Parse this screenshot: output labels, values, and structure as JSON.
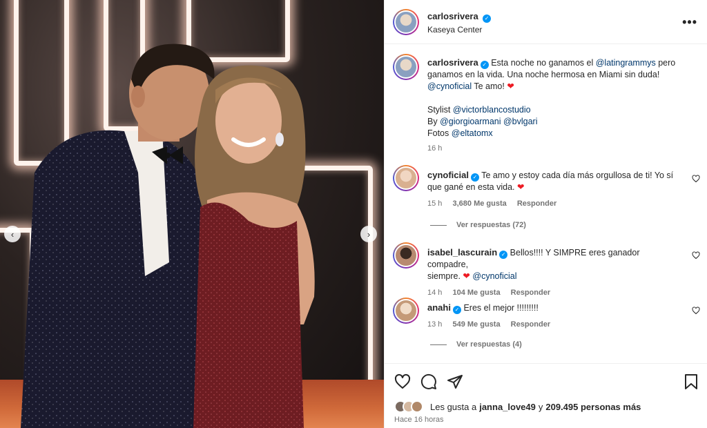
{
  "post": {
    "author": "carlosrivera",
    "location": "Kaseya Center"
  },
  "caption": {
    "author": "carlosrivera",
    "line1_a": "Esta noche no ganamos el",
    "line1_mention": "@latingrammys",
    "line1_b": "pero",
    "line2": "ganamos en la vida. Una noche hermosa en Miami sin duda!",
    "line3_mention": "@cynoficial",
    "line3_text": "Te amo!",
    "stylist_label": "Stylist",
    "stylist_mention": "@victorblancostudio",
    "by_label": "By",
    "by_mention1": "@giorgioarmani",
    "by_mention2": "@bvlgari",
    "photos_label": "Fotos",
    "photos_mention": "@eltatomx",
    "time": "16 h"
  },
  "comments": [
    {
      "author": "cynoficial",
      "text_line1": "Te amo y estoy cada día más orgullosa de ti! Yo sí",
      "text_line2": "que gané en esta vida.",
      "time": "15 h",
      "likes": "3,680 Me gusta",
      "reply": "Responder",
      "view_replies": "Ver respuestas (72)"
    },
    {
      "author": "isabel_lascurain",
      "text_line1": "Bellos!!!! Y SIMPRE eres ganador compadre,",
      "text_line2": "siempre.",
      "mention": "@cynoficial",
      "time": "14 h",
      "likes": "104 Me gusta",
      "reply": "Responder"
    },
    {
      "author": "anahi",
      "text_line1": "Eres el mejor !!!!!!!!!",
      "time": "13 h",
      "likes": "549 Me gusta",
      "reply": "Responder",
      "view_replies": "Ver respuestas (4)"
    }
  ],
  "footer": {
    "likes_prefix": "Les gusta a",
    "likes_user": "janna_love49",
    "likes_joiner": "y",
    "likes_others": "209.495 personas más",
    "posted": "Hace 16 horas"
  },
  "icons": {
    "more": "more-options-icon",
    "like": "heart-icon",
    "comment": "comment-icon",
    "share": "share-icon",
    "save": "bookmark-icon",
    "verified": "verified-badge-icon"
  },
  "colors": {
    "mention": "#00376b",
    "verified": "#0095f6",
    "heart_emoji": "#ed1c24",
    "muted": "#737373"
  }
}
